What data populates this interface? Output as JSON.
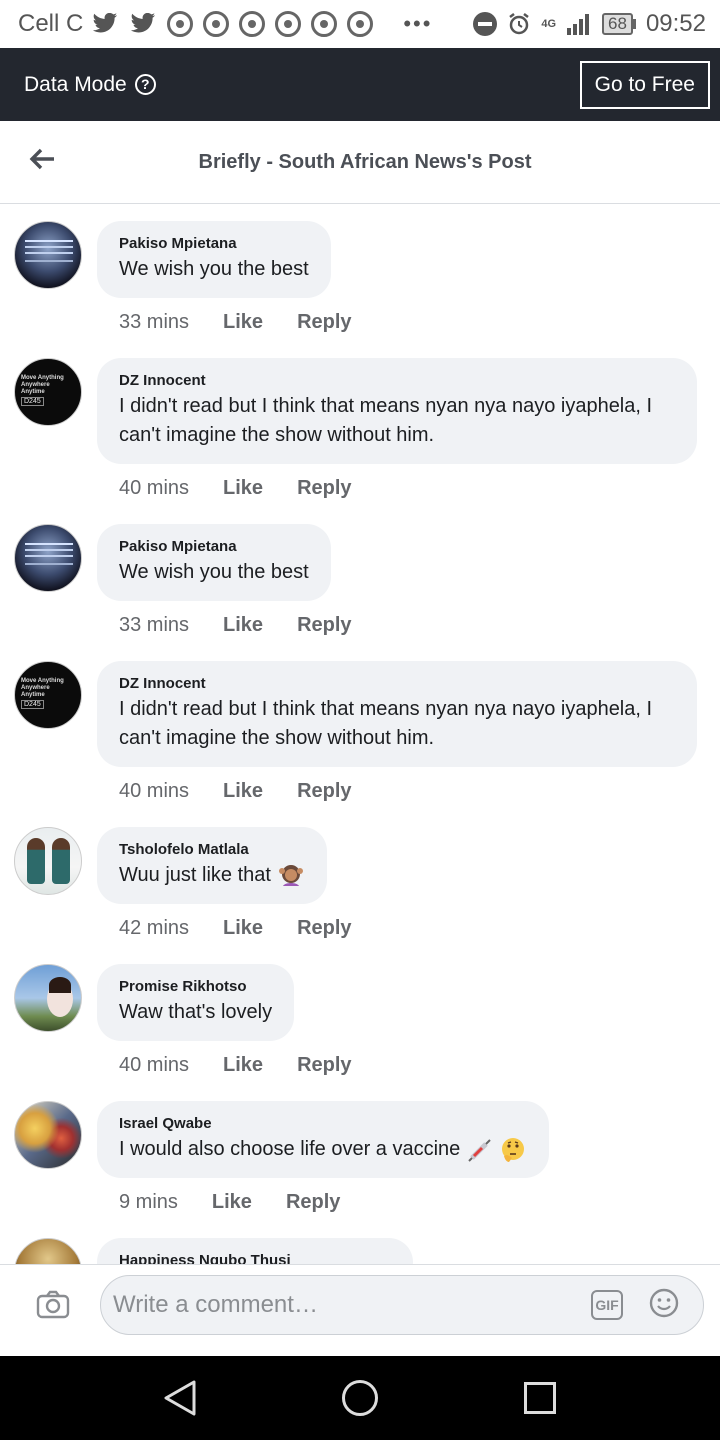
{
  "status_bar": {
    "carrier": "Cell C",
    "battery": "68",
    "time": "09:52",
    "network": "4G"
  },
  "data_mode": {
    "label": "Data Mode",
    "help_symbol": "?",
    "go_free_label": "Go to Free"
  },
  "header": {
    "title": "Briefly - South African News's Post"
  },
  "comments": [
    {
      "author": "Pakiso Mpietana",
      "text": "We wish you the best",
      "time": "33 mins",
      "like": "Like",
      "reply": "Reply",
      "avatar": "avatar-screen"
    },
    {
      "author": "DZ Innocent",
      "text": "I didn't read but I think that means nyan nya nayo iyaphela, I can't imagine the show without him.",
      "time": "40 mins",
      "like": "Like",
      "reply": "Reply",
      "avatar": "avatar-dark-logo"
    },
    {
      "author": "Pakiso Mpietana",
      "text": "We wish you the best",
      "time": "33 mins",
      "like": "Like",
      "reply": "Reply",
      "avatar": "avatar-screen"
    },
    {
      "author": "DZ Innocent",
      "text": "I didn't read but I think that means nyan nya nayo iyaphela, I can't imagine the show without him.",
      "time": "40 mins",
      "like": "Like",
      "reply": "Reply",
      "avatar": "avatar-dark-logo"
    },
    {
      "author": "Tsholofelo Matlala",
      "text": "Wuu just like that",
      "emoji": "person-gesturing-ok-emoji",
      "time": "42 mins",
      "like": "Like",
      "reply": "Reply",
      "avatar": "avatar-two-girls"
    },
    {
      "author": "Promise Rikhotso",
      "text": "Waw that's lovely",
      "time": "40 mins",
      "like": "Like",
      "reply": "Reply",
      "avatar": "avatar-selfie-sky"
    },
    {
      "author": "Israel Qwabe",
      "text": "I would also choose life over a vaccine",
      "emoji": "syringe-and-thinking-emoji",
      "time": "9 mins",
      "like": "Like",
      "reply": "Reply",
      "avatar": "avatar-artwork"
    },
    {
      "author": "Happiness Nqubo Thusi",
      "avatar": "avatar-partial"
    }
  ],
  "composer": {
    "placeholder": "Write a comment…",
    "gif_label": "GIF",
    "camera_icon": "camera-icon",
    "emoji_icon": "smiley-icon"
  },
  "nav": {
    "back_icon": "triangle-back-icon",
    "home_icon": "circle-home-icon",
    "recent_icon": "square-recents-icon"
  }
}
